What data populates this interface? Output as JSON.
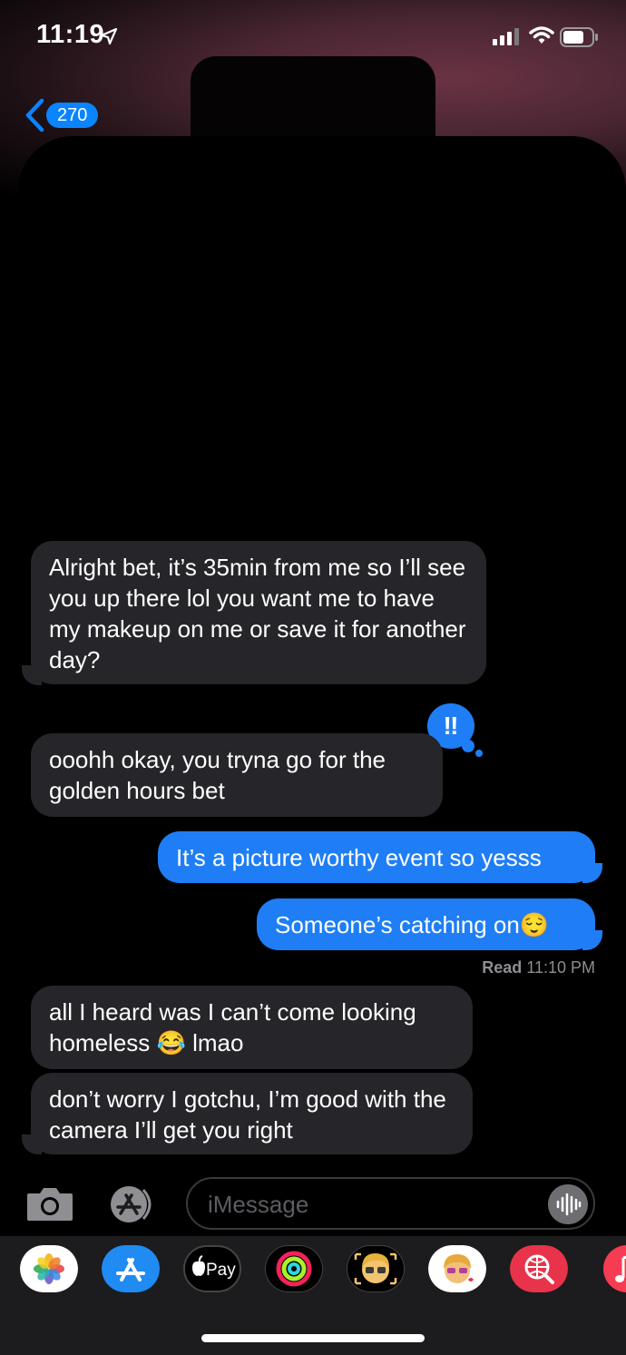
{
  "status_bar": {
    "time": "11:19"
  },
  "nav": {
    "back_count": "270"
  },
  "messages": [
    {
      "from": "them",
      "text": "Alright bet, it’s 35min from me so I’ll see you up there lol you want me to have my makeup on me or save it for another day?"
    },
    {
      "from": "them",
      "text": "ooohh okay, you tryna go for the golden hours bet",
      "tapback": "‼"
    },
    {
      "from": "me",
      "text": "It’s a picture worthy event so yesss"
    },
    {
      "from": "me",
      "text": "Someone’s catching on😌"
    },
    {
      "from": "them",
      "text": "all I heard was I can’t come looking homeless 😂 lmao"
    },
    {
      "from": "them",
      "text": "don’t worry I gotchu, I’m good with the camera I’ll get you right"
    }
  ],
  "read_receipt": {
    "label": "Read",
    "time": "11:10 PM"
  },
  "composer": {
    "placeholder": "iMessage"
  },
  "app_drawer": [
    {
      "name": "photos-app",
      "icon": "photos-icon"
    },
    {
      "name": "app-store-app",
      "icon": "app-store-icon"
    },
    {
      "name": "apple-pay-app",
      "icon": "apple-pay-icon",
      "label": "Pay"
    },
    {
      "name": "activity-app",
      "icon": "activity-rings-icon"
    },
    {
      "name": "memoji-app",
      "icon": "memoji-icon"
    },
    {
      "name": "memoji-stickers-app",
      "icon": "memoji-sticker-icon"
    },
    {
      "name": "web-search-app",
      "icon": "globe-search-icon"
    },
    {
      "name": "music-app",
      "icon": "music-icon"
    }
  ],
  "colors": {
    "sent_bubble": "#1f7ef6",
    "received_bubble": "#26252a",
    "accent": "#0a84ff"
  }
}
